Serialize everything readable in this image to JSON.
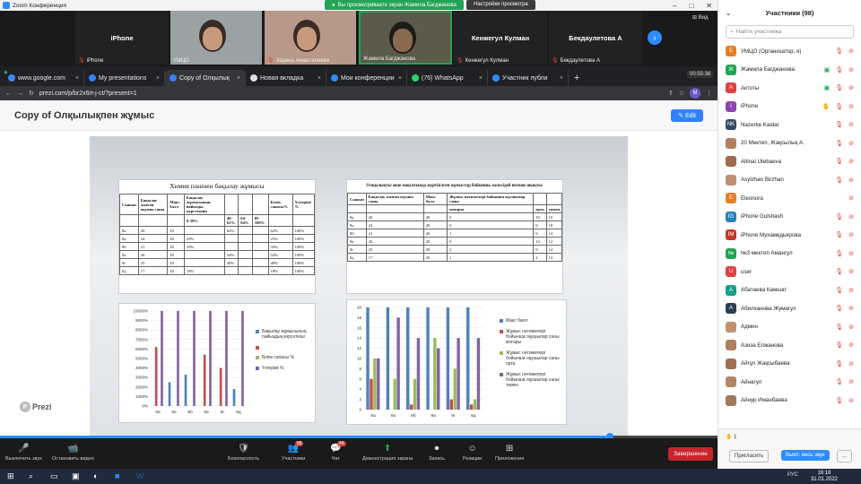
{
  "window": {
    "title": "Zoom Конференция"
  },
  "share_banner": {
    "text": "Вы просматриваете экран Жамила Багджанова",
    "options_label": "Настройки просмотра",
    "view_label": "Вид"
  },
  "gallery": {
    "tiles": [
      {
        "name": "iPhone",
        "label": "iPhone",
        "video": false
      },
      {
        "name": "",
        "label": "УМЦО",
        "video": true
      },
      {
        "name": "",
        "label": "Зарина Аманталиева",
        "video": true
      },
      {
        "name": "",
        "label": "Жамила Багджанова",
        "video": true
      },
      {
        "name": "Кенжегул Кулман",
        "label": "Кенжегул Кулман",
        "video": false
      },
      {
        "name": "Бекдаулетова А",
        "label": "Бекдаулетова А",
        "video": false
      }
    ]
  },
  "browser": {
    "tabs": [
      {
        "title": "www.google.com",
        "color": "#4285f4",
        "active": false
      },
      {
        "title": "My presentations",
        "color": "#3181ff",
        "active": false
      },
      {
        "title": "Copy of Олқылық",
        "color": "#3181ff",
        "active": true
      },
      {
        "title": "Новая вкладка",
        "color": "#dddddd",
        "active": false
      },
      {
        "title": "Мои конференции",
        "color": "#2d8cff",
        "active": false
      },
      {
        "title": "(76) WhatsApp",
        "color": "#25d366",
        "active": false
      },
      {
        "title": "Участник публи",
        "color": "#2d8cff",
        "active": false
      }
    ],
    "new_tab": "+",
    "timer": "00:55:36",
    "url": "prezi.com/p/br2x6rt-j-ct/?present=1",
    "profile_initial": "M"
  },
  "prezi": {
    "title": "Copy of Олқылықпен жұмыс",
    "edit_label": "Edit",
    "logo": "Prezi"
  },
  "slide": {
    "table1": {
      "title": "Химия пәнінен бақылау жұмысы",
      "headers": [
        "Сынып",
        "Бақылау жазған оқушы саны",
        "Макс балл",
        "Бақылау жұмысының пайызды көрсеткіші",
        "",
        "",
        "",
        "Білім сапасы%",
        "Үлгерімі %"
      ],
      "subheaders": [
        "",
        "",
        "",
        "0-39%",
        "40-63%",
        "64-84%",
        "85-100%",
        "",
        ""
      ],
      "rows": [
        [
          "8а",
          "26",
          "20",
          "",
          "62%",
          "",
          "",
          "62%",
          "100%"
        ],
        [
          "8ә",
          "24",
          "20",
          "25%",
          "",
          "",
          "",
          "25%",
          "100%"
        ],
        [
          "8б",
          "21",
          "20",
          "33%",
          "",
          "",
          "",
          "33%",
          "100%"
        ],
        [
          "9а",
          "26",
          "20",
          "",
          "54%",
          "",
          "",
          "54%",
          "100%"
        ],
        [
          "9г",
          "25",
          "20",
          "",
          "40%",
          "",
          "",
          "40%",
          "100%"
        ],
        [
          "8д",
          "17",
          "20",
          "18%",
          "",
          "",
          "",
          "18%",
          "100%"
        ]
      ]
    },
    "table2": {
      "title": "Олқылықты жою мақсатында жүргізілген жұмыстар бойынша, келесідей нәтиже шықты:",
      "headers": [
        "Сынып",
        "Бақылау жазған оқушы саны",
        "Макс балл",
        "Жұмыс нәтижелері бойынша оқушылар саны",
        "",
        ""
      ],
      "subheaders": [
        "",
        "",
        "",
        "жоғары",
        "орта",
        "төмен"
      ],
      "rows": [
        [
          "8а",
          "26",
          "20",
          "6",
          "10",
          "10"
        ],
        [
          "8ә",
          "24",
          "20",
          "0",
          "6",
          "18"
        ],
        [
          "8б",
          "21",
          "20",
          "1",
          "6",
          "14"
        ],
        [
          "9а",
          "26",
          "20",
          "0",
          "14",
          "12"
        ],
        [
          "9г",
          "25",
          "20",
          "2",
          "8",
          "14"
        ],
        [
          "8д",
          "17",
          "20",
          "1",
          "2",
          "14"
        ]
      ]
    }
  },
  "chart_data": [
    {
      "type": "bar",
      "categories": [
        "8а",
        "8ә",
        "8б",
        "9а",
        "9г",
        "8д"
      ],
      "ylim": [
        0,
        10000
      ],
      "yticks": [
        "0%",
        "1000%",
        "2000%",
        "3000%",
        "4000%",
        "5000%",
        "6000%",
        "7000%",
        "8000%",
        "9000%",
        "10000%"
      ],
      "series": [
        {
          "name": "Бақылау жұмысының пайыздық көрсеткіші",
          "color": "#4f81bd",
          "values": [
            0,
            2500,
            3300,
            0,
            0,
            1800
          ]
        },
        {
          "name": "",
          "color": "#c0504d",
          "values": [
            6200,
            0,
            0,
            5400,
            4000,
            0
          ]
        },
        {
          "name": "Білім сапасы %",
          "color": "#9bbb59",
          "values": [
            0,
            0,
            0,
            0,
            0,
            0
          ]
        },
        {
          "name": "Үлгерімі %",
          "color": "#8064a2",
          "values": [
            10000,
            10000,
            10000,
            10000,
            10000,
            10000
          ]
        }
      ]
    },
    {
      "type": "bar",
      "categories": [
        "8а",
        "8ә",
        "8б",
        "9а",
        "9г",
        "8д"
      ],
      "ylim": [
        0,
        20
      ],
      "yticks": [
        "0",
        "2",
        "4",
        "6",
        "8",
        "10",
        "12",
        "14",
        "16",
        "18",
        "20"
      ],
      "series": [
        {
          "name": "Макс балл",
          "color": "#4f81bd",
          "values": [
            20,
            20,
            20,
            20,
            20,
            20
          ]
        },
        {
          "name": "Жұмыс нәтижелері бойынша оқушылар саны жоғары",
          "color": "#c0504d",
          "values": [
            6,
            0,
            1,
            0,
            2,
            1
          ]
        },
        {
          "name": "Жұмыс нәтижелері бойынша оқушылар саны орта",
          "color": "#9bbb59",
          "values": [
            10,
            6,
            6,
            14,
            8,
            2
          ]
        },
        {
          "name": "Жұмыс нәтижелері бойынша оқушылар саны төмен",
          "color": "#8064a2",
          "values": [
            10,
            18,
            14,
            12,
            14,
            14
          ]
        }
      ]
    }
  ],
  "toolbar": {
    "items": [
      {
        "label": "Выключить звук",
        "icon": "🎤"
      },
      {
        "label": "Остановить видео",
        "icon": "📹"
      },
      {
        "label": "Безопасность",
        "icon": "🛡"
      },
      {
        "label": "Участники",
        "icon": "👥",
        "badge": "98"
      },
      {
        "label": "Чат",
        "icon": "💬",
        "badge": "44"
      },
      {
        "label": "Демонстрация экрана",
        "icon": "⬆"
      },
      {
        "label": "Запись",
        "icon": "⏺"
      },
      {
        "label": "Реакции",
        "icon": "☺"
      },
      {
        "label": "Приложения",
        "icon": "⊞"
      }
    ],
    "end_label": "Завершение",
    "progress": 0.85
  },
  "participants": {
    "title": "Участники (98)",
    "search_placeholder": "Найти участника",
    "list": [
      {
        "initial": "Б",
        "name": "УМЦО (Организатор, я)",
        "color": "#e67e22",
        "icons": [
          "mic",
          "video"
        ]
      },
      {
        "initial": "Ж",
        "name": "Жамила Багджанова",
        "color": "#23a455",
        "icons": [
          "share",
          "mic",
          "video"
        ]
      },
      {
        "initial": "А",
        "name": "Актоты",
        "color": "#e0403f",
        "icons": [
          "share",
          "mic",
          "video"
        ]
      },
      {
        "initial": "I",
        "name": "iPhone",
        "color": "#8e44ad",
        "icons": [
          "hand",
          "mic",
          "video"
        ]
      },
      {
        "initial": "NK",
        "name": "Nazerke Kaidar",
        "color": "#34495e",
        "icons": [
          "mic",
          "video"
        ]
      },
      {
        "initial": "",
        "name": "20 Мектеп, Жақсылық А.",
        "color": "#b08060",
        "icons": [
          "mic",
          "video"
        ]
      },
      {
        "initial": "",
        "name": "Altinai Utebaeva",
        "color": "#a06a50",
        "icons": [
          "mic",
          "video"
        ]
      },
      {
        "initial": "",
        "name": "Asylzhan Birzhan",
        "color": "#c09070",
        "icons": [
          "mic",
          "video"
        ]
      },
      {
        "initial": "E",
        "name": "Eleonora",
        "color": "#e67e22",
        "icons": [
          "video"
        ]
      },
      {
        "initial": "IG",
        "name": "iPhone Gulshash",
        "color": "#2980b9",
        "icons": [
          "mic",
          "video"
        ]
      },
      {
        "initial": "IM",
        "name": "iPhone Мухамедьярова",
        "color": "#c0392b",
        "icons": [
          "mic",
          "video"
        ]
      },
      {
        "initial": "№",
        "name": "№3 мектеп Амангул",
        "color": "#23a455",
        "icons": [
          "mic",
          "video"
        ]
      },
      {
        "initial": "U",
        "name": "user",
        "color": "#e0403f",
        "icons": [
          "mic",
          "video"
        ]
      },
      {
        "initial": "А",
        "name": "Абатаева Камшат",
        "color": "#16a085",
        "icons": [
          "mic",
          "video"
        ]
      },
      {
        "initial": "А",
        "name": "Абилханова Жумагул",
        "color": "#2c3e50",
        "icons": [
          "mic",
          "video"
        ]
      },
      {
        "initial": "",
        "name": "Админ",
        "color": "#c09070",
        "icons": [
          "mic",
          "video"
        ]
      },
      {
        "initial": "",
        "name": "Азиза Елжанова",
        "color": "#b08060",
        "icons": [
          "mic",
          "video"
        ]
      },
      {
        "initial": "",
        "name": "Айгул Жақсыбаева",
        "color": "#a07050",
        "icons": [
          "mic",
          "video"
        ]
      },
      {
        "initial": "",
        "name": "Айнагул",
        "color": "#b08868",
        "icons": [
          "mic",
          "video"
        ]
      },
      {
        "initial": "",
        "name": "Айнур Иманбаева",
        "color": "#a0785a",
        "icons": [
          "mic",
          "video"
        ]
      }
    ],
    "hand_count": "1",
    "invite_label": "Пригласить",
    "mute_all_label": "Выкл. весь звук",
    "more_label": "..."
  },
  "taskbar": {
    "lang": "РУС",
    "time": "16:18",
    "date": "31.01.2022"
  }
}
